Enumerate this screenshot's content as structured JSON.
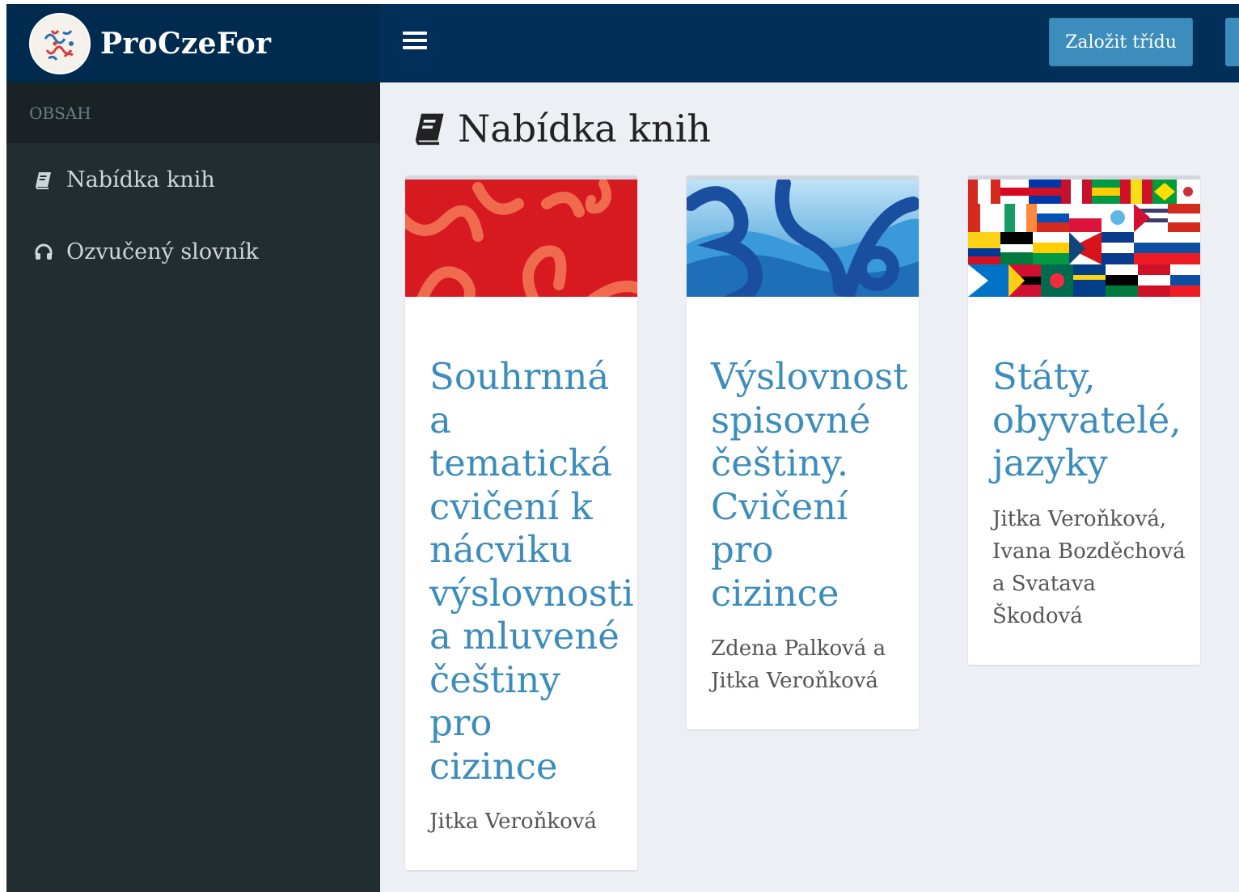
{
  "app": {
    "name": "ProCzeFor",
    "logo_icon": "proczefor-logo-icon"
  },
  "colors": {
    "accent": "#3c8dbc",
    "topbar": "#002f5a",
    "sidebar": "#222d32",
    "content_bg": "#ecf0f5"
  },
  "sidebar": {
    "section_label": "OBSAH",
    "items": [
      {
        "label": "Nabídka knih",
        "icon": "book-icon"
      },
      {
        "label": "Ozvučený slovník",
        "icon": "headphones-icon"
      }
    ]
  },
  "topbar": {
    "menu_icon": "hamburger-menu-icon",
    "create_class_label": "Založit třídu"
  },
  "page": {
    "title": "Nabídka knih",
    "title_icon": "book-icon"
  },
  "books": [
    {
      "title": "Souhrnná a tematická cvičení k nácviku výslovnosti a mluvené češtiny pro cizince",
      "authors": "Jitka Veroňková",
      "cover": "red-cover-with-loops"
    },
    {
      "title": "Výslovnost spisovné češtiny. Cvičení pro cizince",
      "authors": "Zdena Palková a Jitka Veroňková",
      "cover": "blue-mountains-cover"
    },
    {
      "title": "Státy, obyvatelé, jazyky",
      "authors": "Jitka Veroňková, Ivana Bozděchová a Svatava Škodová",
      "cover": "world-flags-cover"
    }
  ]
}
